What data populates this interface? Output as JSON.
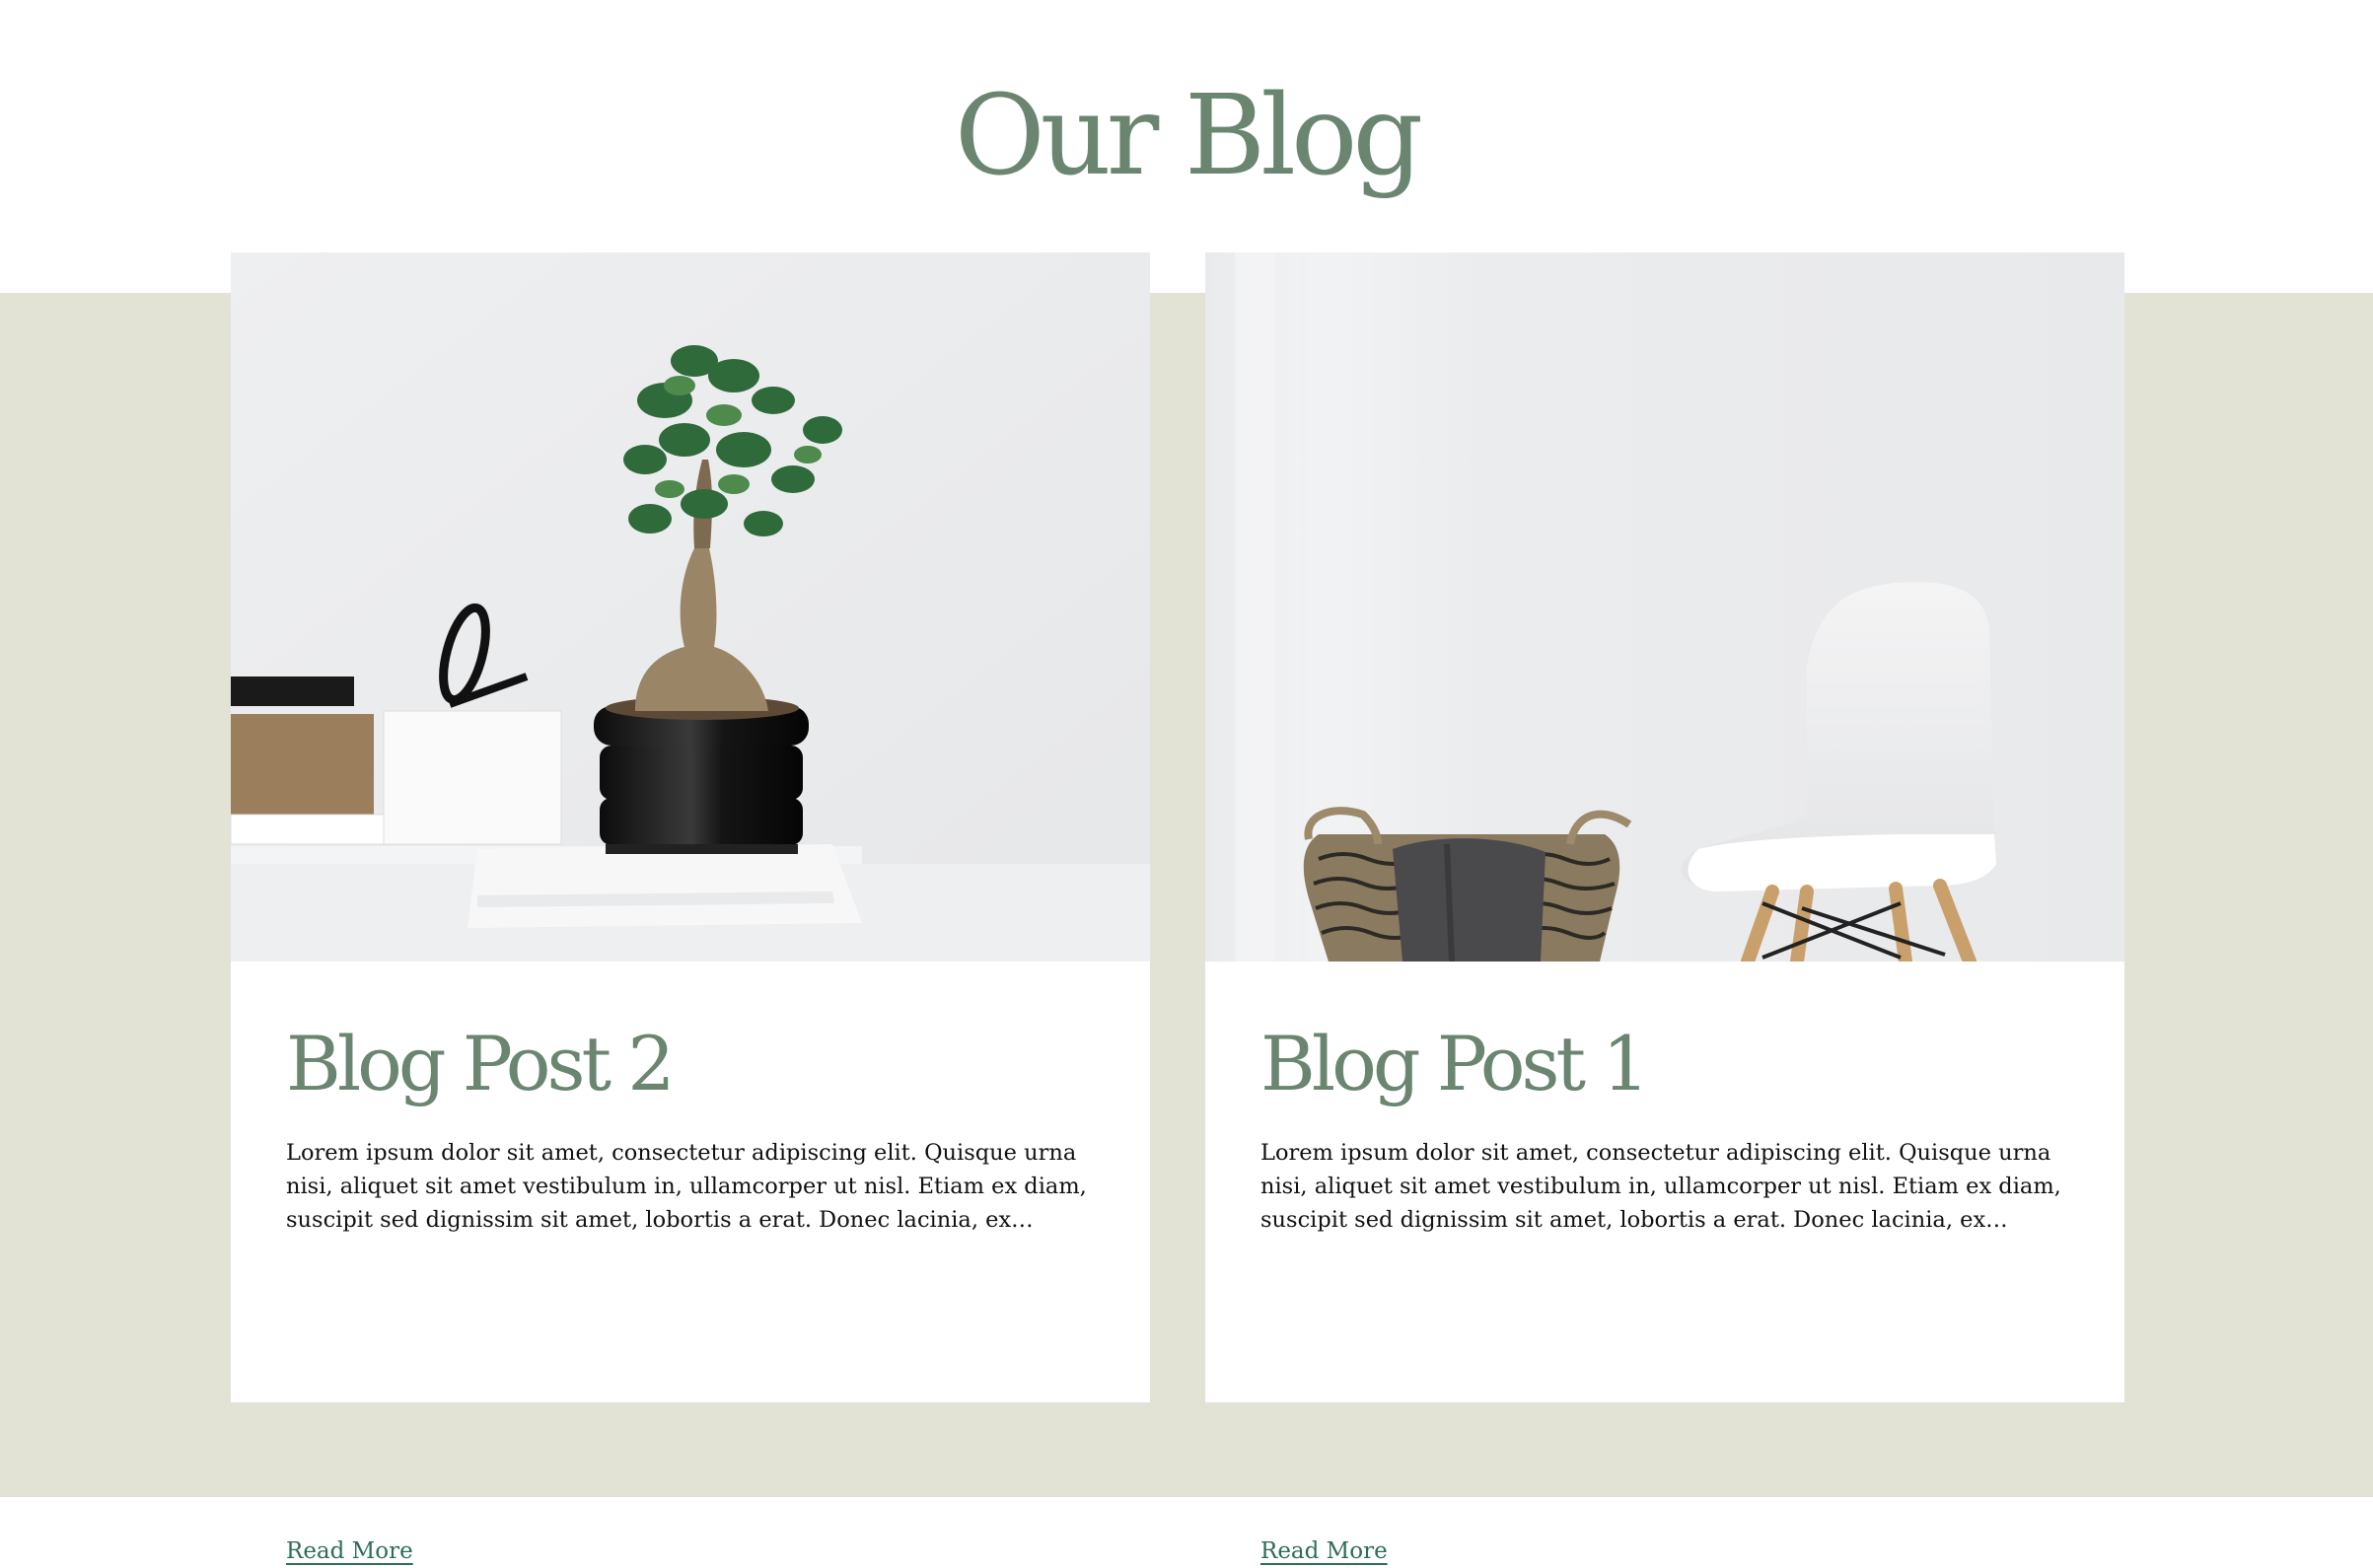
{
  "section": {
    "title": "Our Blog"
  },
  "posts": [
    {
      "title": "Blog Post 2",
      "excerpt": "Lorem ipsum dolor sit amet, consectetur adipiscing elit. Quisque urna nisi, aliquet sit amet vestibulum in, ullamcorper ut nisl. Etiam ex diam, suscipit sed dignissim sit amet, lobortis a erat. Donec lacinia, ex…",
      "link_label": "Read More"
    },
    {
      "title": "Blog Post 1",
      "excerpt": "Lorem ipsum dolor sit amet, consectetur adipiscing elit. Quisque urna nisi, aliquet sit amet vestibulum in, ullamcorper ut nisl. Etiam ex diam, suscipit sed dignissim sit amet, lobortis a erat. Donec lacinia, ex…",
      "link_label": "Read More"
    }
  ],
  "colors": {
    "accent": "#6a8570",
    "link": "#2e6e54",
    "band_background": "#e2e3d5",
    "card_background": "#ffffff"
  }
}
